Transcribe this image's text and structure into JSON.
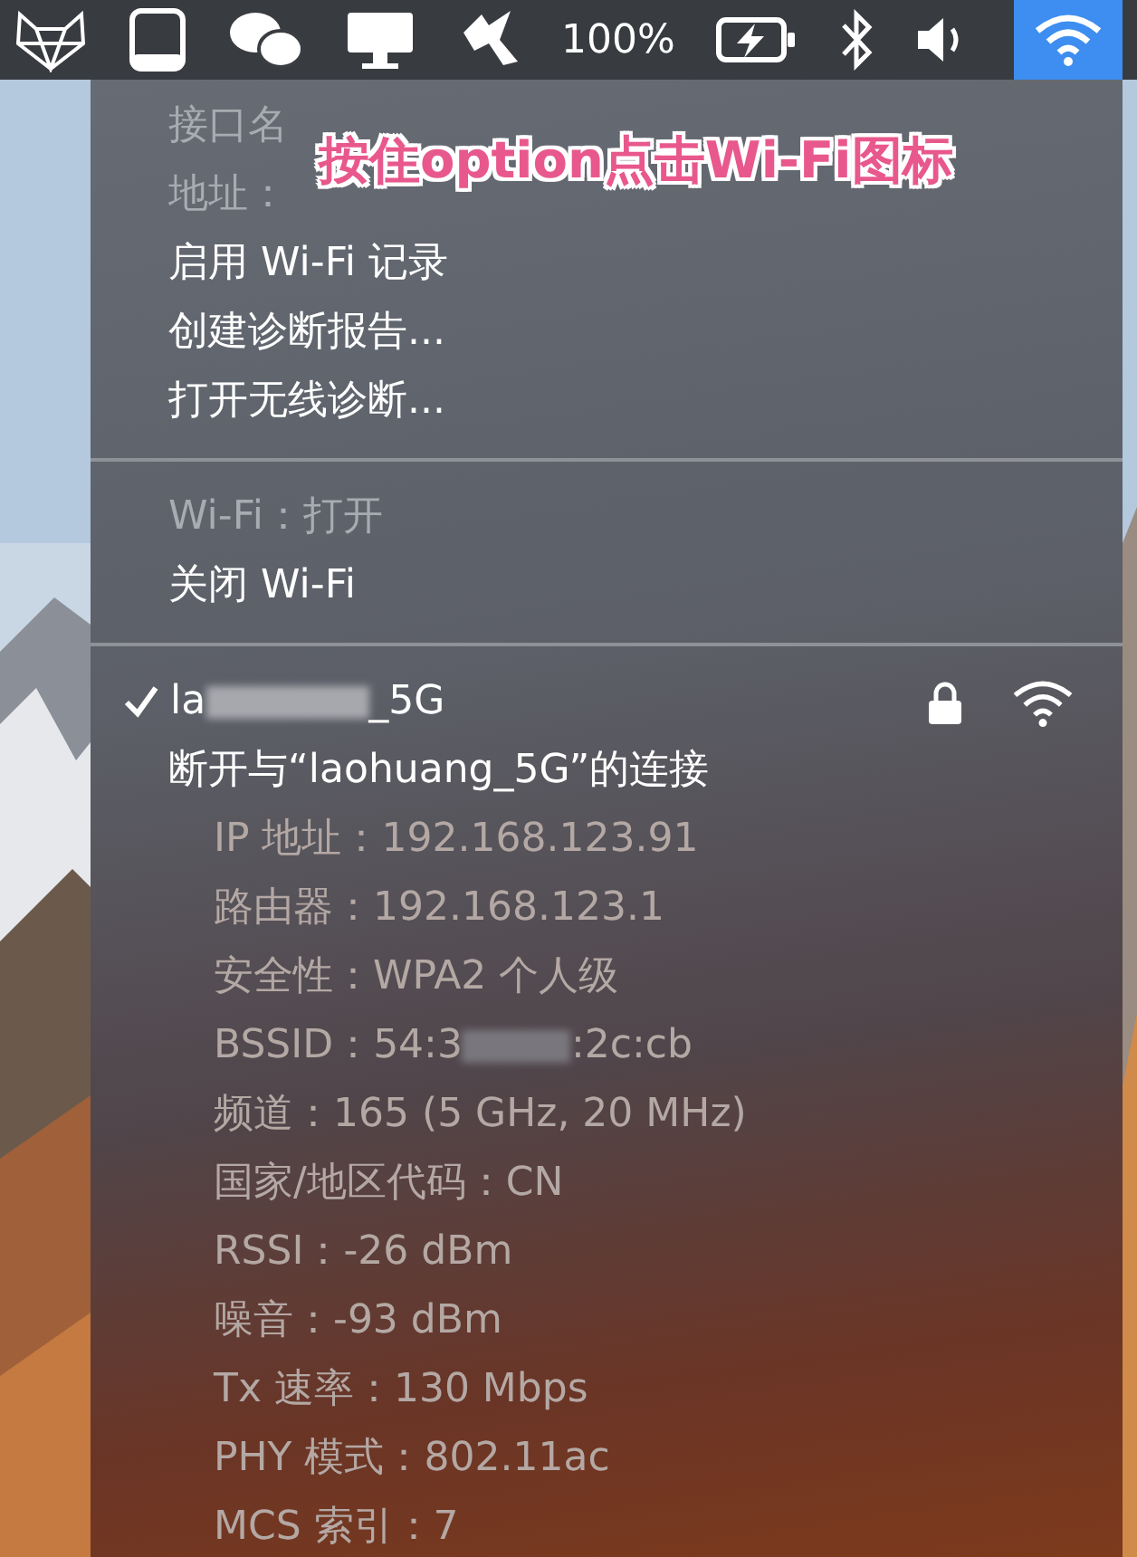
{
  "menu_bar": {
    "battery_text": "100%",
    "wifi_active": true
  },
  "callout": "按住option点击Wi-Fi图标",
  "sections": [
    {
      "items": [
        {
          "kind": "info",
          "text": "接口名"
        },
        {
          "kind": "info",
          "text": "地址："
        },
        {
          "kind": "action",
          "text": "启用 Wi-Fi 记录"
        },
        {
          "kind": "action",
          "text": "创建诊断报告..."
        },
        {
          "kind": "action",
          "text": "打开无线诊断..."
        }
      ]
    },
    {
      "items": [
        {
          "kind": "info",
          "text": "Wi-Fi：打开"
        },
        {
          "kind": "action",
          "text": "关闭 Wi-Fi"
        }
      ]
    },
    {
      "items": [
        {
          "kind": "network",
          "text": "la",
          "text_end": "_5G",
          "selected": true,
          "locked": true
        },
        {
          "kind": "action",
          "text": "断开与“laohuang_5G”的连接"
        },
        {
          "kind": "detail",
          "text": "IP 地址：192.168.123.91"
        },
        {
          "kind": "detail",
          "text": "路由器：192.168.123.1"
        },
        {
          "kind": "detail",
          "text": "安全性：WPA2 个人级"
        },
        {
          "kind": "masked",
          "text": "BSSID：54:3",
          "text_end": ":2c:cb"
        },
        {
          "kind": "detail",
          "text": "频道：165 (5 GHz, 20 MHz)"
        },
        {
          "kind": "detail",
          "text": "国家/地区代码：CN"
        },
        {
          "kind": "detail",
          "text": "RSSI：-26 dBm"
        },
        {
          "kind": "detail",
          "text": "噪音：-93 dBm"
        },
        {
          "kind": "detail",
          "text": "Tx 速率：130 Mbps"
        },
        {
          "kind": "detail",
          "text": "PHY 模式：802.11ac"
        },
        {
          "kind": "detail",
          "text": "MCS 索引：7"
        }
      ]
    }
  ]
}
